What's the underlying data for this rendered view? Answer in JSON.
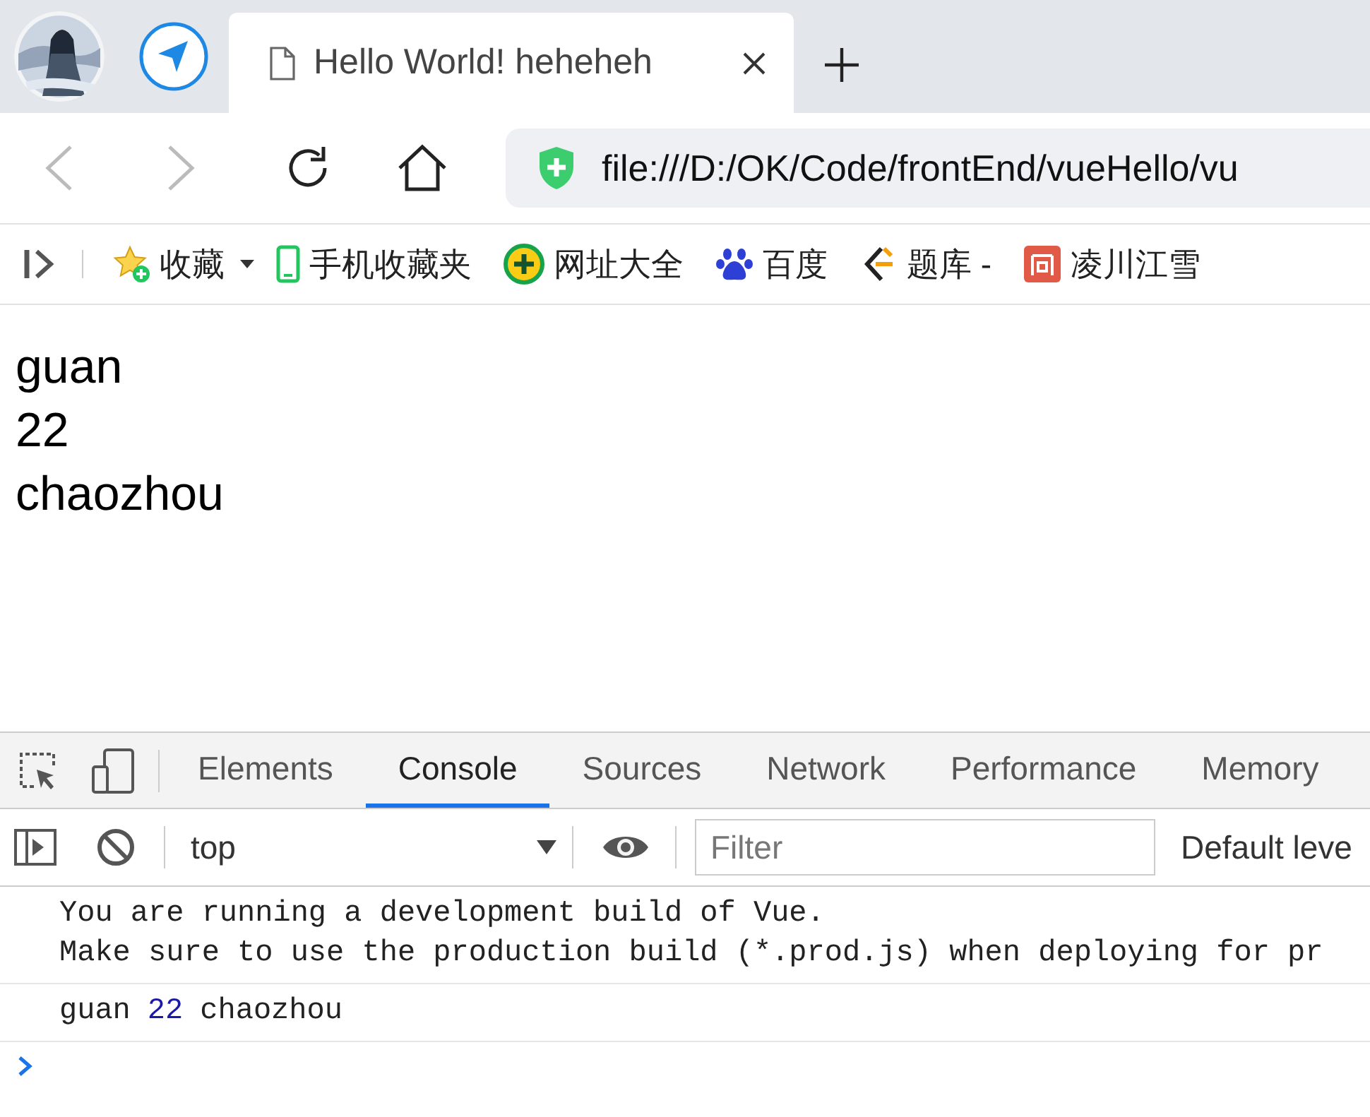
{
  "browser": {
    "tab": {
      "title": "Hello World! heheheh"
    },
    "address": "file:///D:/OK/Code/frontEnd/vueHello/vu",
    "bookmarks": [
      {
        "label": "收藏",
        "kind": "star"
      },
      {
        "label": "手机收藏夹",
        "kind": "phone"
      },
      {
        "label": "网址大全",
        "kind": "globe"
      },
      {
        "label": "百度",
        "kind": "paw"
      },
      {
        "label": "题库 -",
        "kind": "book"
      },
      {
        "label": "凌川江雪",
        "kind": "jian"
      }
    ]
  },
  "page": {
    "lines": [
      "guan",
      "22",
      "chaozhou"
    ]
  },
  "devtools": {
    "tabs": [
      {
        "label": "Elements",
        "selected": false
      },
      {
        "label": "Console",
        "selected": true
      },
      {
        "label": "Sources",
        "selected": false
      },
      {
        "label": "Network",
        "selected": false
      },
      {
        "label": "Performance",
        "selected": false
      },
      {
        "label": "Memory",
        "selected": false
      }
    ],
    "context": "top",
    "filter": {
      "placeholder": "Filter"
    },
    "levels": "Default leve",
    "messages": [
      {
        "lines": [
          "You are running a development build of Vue.",
          "Make sure to use the production build (*.prod.js) when deploying for pr"
        ]
      },
      {
        "parts": [
          {
            "text": "guan",
            "kind": "string"
          },
          {
            "text": "22",
            "kind": "number"
          },
          {
            "text": "chaozhou",
            "kind": "string"
          }
        ]
      }
    ]
  }
}
